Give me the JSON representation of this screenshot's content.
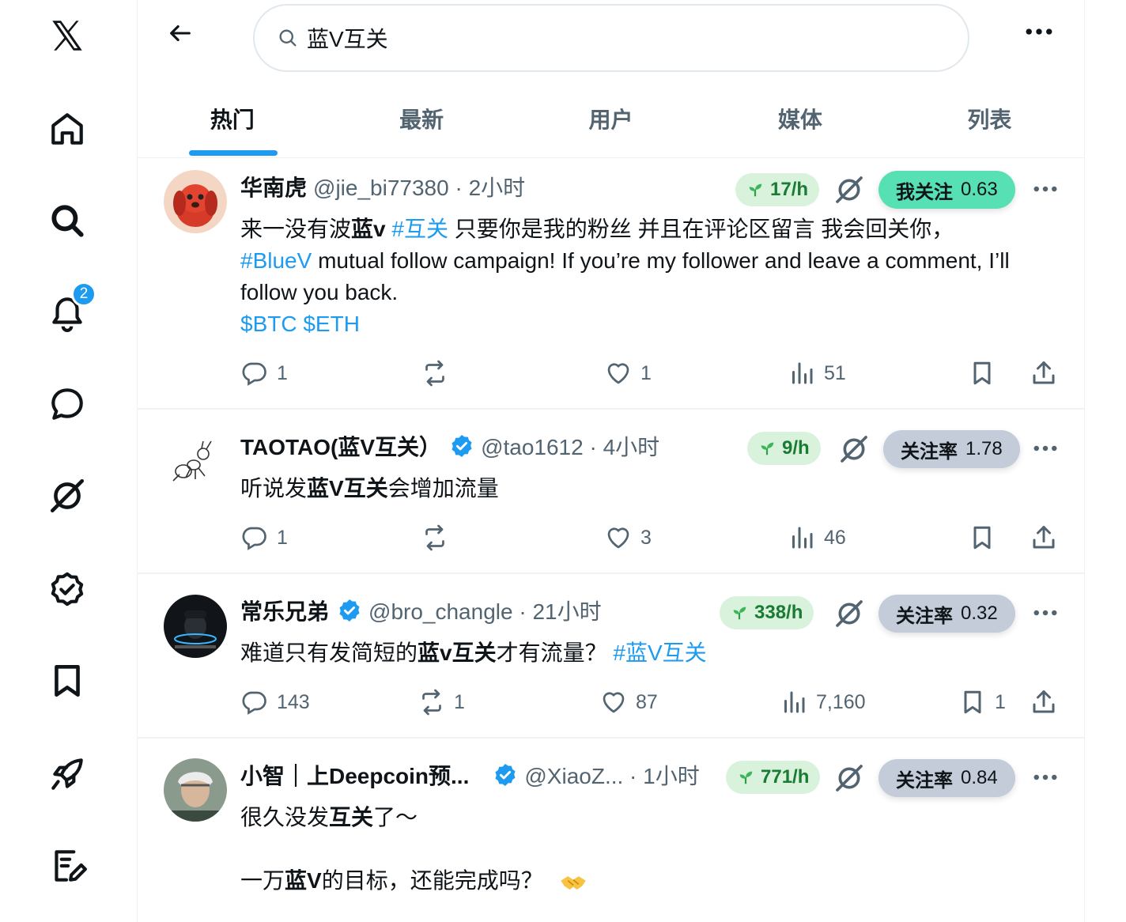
{
  "nav": {
    "notification_count": "2"
  },
  "search": {
    "value": "蓝V互关"
  },
  "tabs": [
    {
      "label": "热门",
      "active": true
    },
    {
      "label": "最新"
    },
    {
      "label": "用户"
    },
    {
      "label": "媒体"
    },
    {
      "label": "列表"
    }
  ],
  "posts": [
    {
      "author": "华南虎",
      "handle": "@jie_bi77380 · 2小时",
      "rate": "17/h",
      "follow_label": "我关注",
      "follow_value": "0.63",
      "text_parts": {
        "p1": "来一没有波",
        "p2": "蓝v",
        "p3": " ",
        "tag1": "#互关",
        "p4": " 只要你是我的粉丝 并且在评论区留言 我会回关你，",
        "tag2": " #BlueV",
        "p5": " mutual follow campaign! If you’re my follower and leave a comment, I’ll follow you back.",
        "cash": "$BTC $ETH"
      },
      "replies": "1",
      "reposts": "",
      "likes": "1",
      "views": "51",
      "bookmarks": ""
    },
    {
      "author": "TAOTAO(蓝V互关）",
      "handle": "@tao1612 · 4小时",
      "rate": "9/h",
      "follow_label": "关注率",
      "follow_value": "1.78",
      "text_parts": {
        "p1": "听说发",
        "p2": "蓝V互关",
        "p3": "会增加流量"
      },
      "replies": "1",
      "reposts": "",
      "likes": "3",
      "views": "46",
      "bookmarks": ""
    },
    {
      "author": "常乐兄弟",
      "handle": "@bro_changle · 21小时",
      "rate": "338/h",
      "follow_label": "关注率",
      "follow_value": "0.32",
      "text_parts": {
        "p1": "难道只有发简短的",
        "p2": "蓝v互关",
        "p3": "才有流量？ ",
        "tag1": "#蓝V互关"
      },
      "replies": "143",
      "reposts": "1",
      "likes": "87",
      "views": "7,160",
      "bookmarks": "1"
    },
    {
      "author": "小智｜上Deepcoin预...",
      "handle": "@XiaoZ... · 1小时",
      "rate": "771/h",
      "follow_label": "关注率",
      "follow_value": "0.84",
      "text_parts": {
        "p1": "很久没发",
        "p2": "互关",
        "p3": "了～",
        "p4": "一万",
        "p5": "蓝V",
        "p6": "的目标，还能完成吗？"
      }
    }
  ]
}
